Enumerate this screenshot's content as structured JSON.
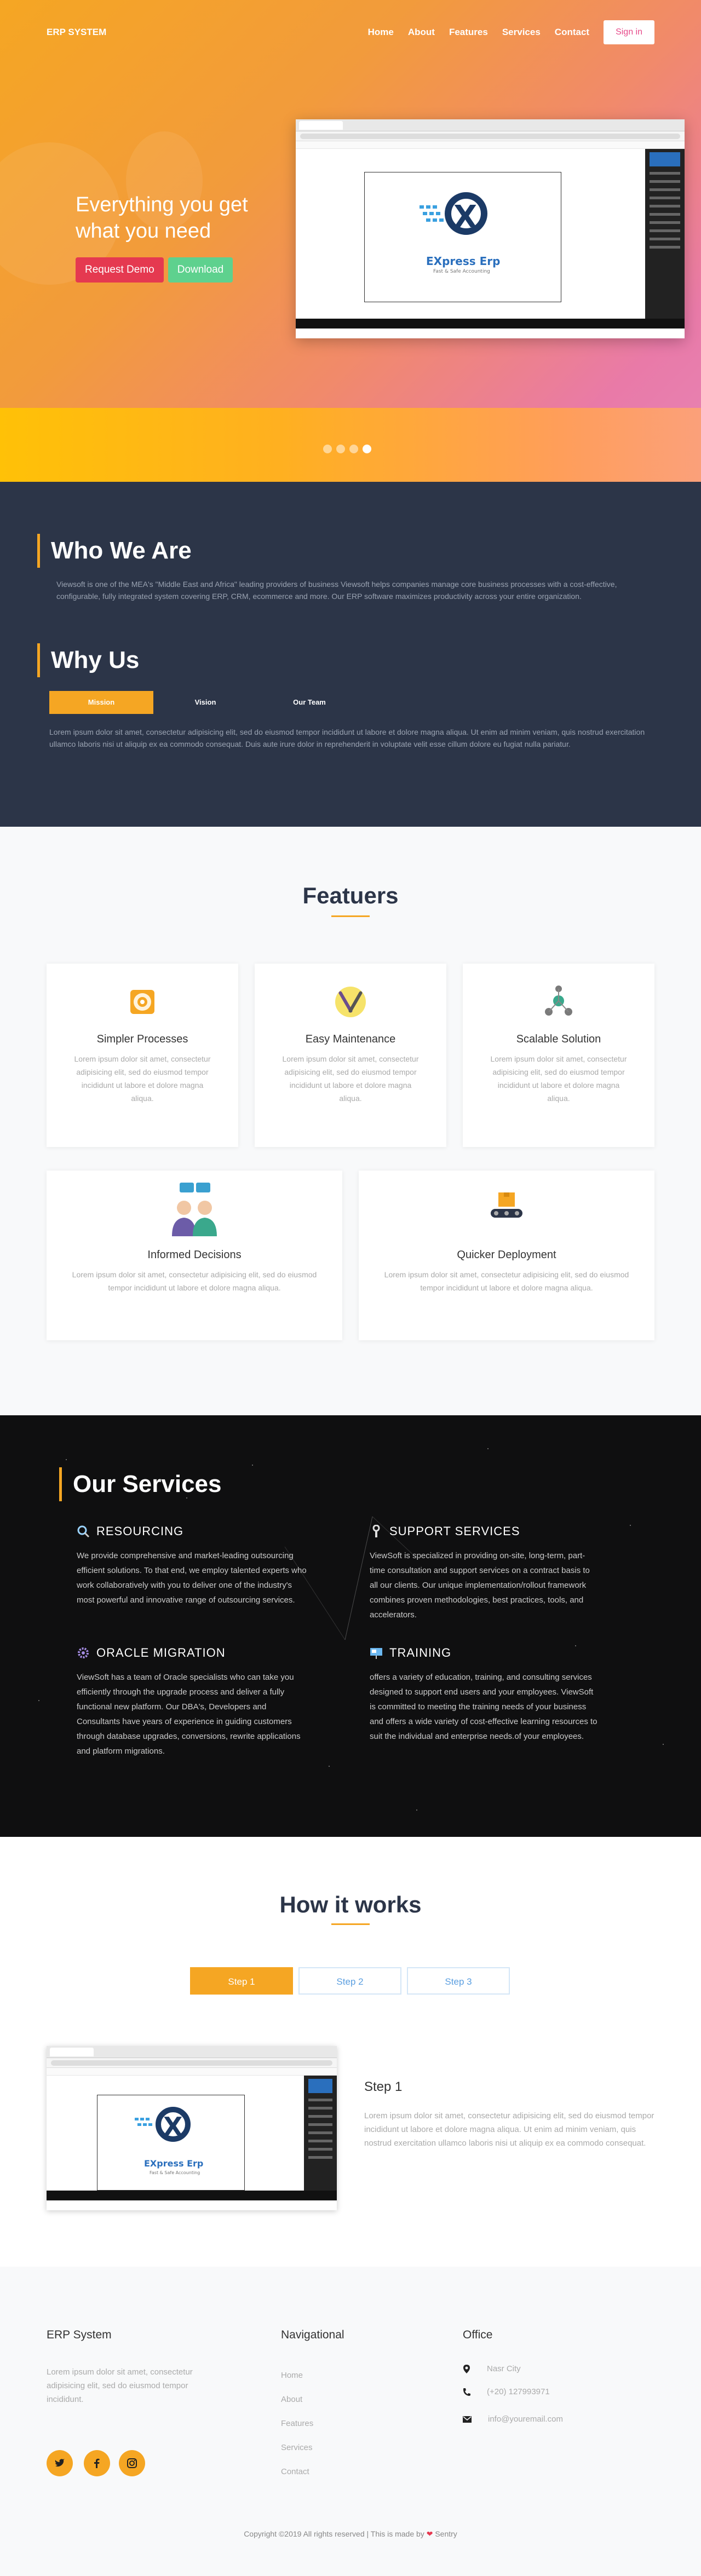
{
  "nav": {
    "logo": "ERP SYSTEM",
    "links": [
      "Home",
      "About",
      "Features",
      "Services",
      "Contact"
    ],
    "signin": "Sign in"
  },
  "hero": {
    "title": "Everything you get what you need",
    "btn_demo": "Request Demo",
    "btn_download": "Download",
    "logo_text": "EXpress Erp",
    "logo_tag": "Fast & Safe Accounting",
    "slide_count": 4,
    "active_slide": 4
  },
  "about": {
    "who_title": "Who We Are",
    "who_text": "Viewsoft is one of the MEA's \"Middle East and Africa\" leading providers of business Viewsoft helps companies manage core business processes with a cost-effective, configurable, fully integrated system covering ERP, CRM, ecommerce and more. Our ERP software maximizes productivity across your entire organization.",
    "why_title": "Why Us",
    "tabs": [
      "Mission",
      "Vision",
      "Our Team"
    ],
    "tab_text": "Lorem ipsum dolor sit amet, consectetur adipisicing elit, sed do eiusmod tempor incididunt ut labore et dolore magna aliqua. Ut enim ad minim veniam, quis nostrud exercitation ullamco laboris nisi ut aliquip ex ea commodo consequat. Duis aute irure dolor in reprehenderit in voluptate velit esse cillum dolore eu fugiat nulla pariatur."
  },
  "features": {
    "title": "Featuers",
    "items": [
      {
        "title": "Simpler Processes",
        "text": "Lorem ipsum dolor sit amet, consectetur adipisicing elit, sed do eiusmod tempor incididunt ut labore et dolore magna aliqua.",
        "icon": "gear-box-icon"
      },
      {
        "title": "Easy Maintenance",
        "text": "Lorem ipsum dolor sit amet, consectetur adipisicing elit, sed do eiusmod tempor incididunt ut labore et dolore magna aliqua.",
        "icon": "tools-icon"
      },
      {
        "title": "Scalable Solution",
        "text": "Lorem ipsum dolor sit amet, consectetur adipisicing elit, sed do eiusmod tempor incididunt ut labore et dolore magna aliqua.",
        "icon": "network-icon"
      },
      {
        "title": "Informed Decisions",
        "text": "Lorem ipsum dolor sit amet, consectetur adipisicing elit, sed do eiusmod tempor incididunt ut labore et dolore magna aliqua.",
        "icon": "people-chat-icon"
      },
      {
        "title": "Quicker Deployment",
        "text": "Lorem ipsum dolor sit amet, consectetur adipisicing elit, sed do eiusmod tempor incididunt ut labore et dolore magna aliqua.",
        "icon": "conveyor-icon"
      }
    ]
  },
  "services": {
    "title": "Our Services",
    "items": [
      {
        "title": "RESOURCING",
        "text": "We provide comprehensive and market-leading outsourcing efficient solutions. To that end, we employ talented experts who work collaboratively with you to deliver one of the industry's most powerful and innovative range of outsourcing services.",
        "icon": "magnifier-icon"
      },
      {
        "title": "SUPPORT SERVICES",
        "text": "ViewSoft is specialized in providing on-site, long-term, part-time consultation and support services on a contract basis to all our clients. Our unique implementation/rollout framework combines proven methodologies, best practices, tools, and accelerators.",
        "icon": "wrench-icon"
      },
      {
        "title": "ORACLE MIGRATION",
        "text": "ViewSoft has a team of Oracle specialists who can take you efficiently through the upgrade process and deliver a fully functional new platform. Our DBA's, Developers and Consultants have years of experience in guiding customers through database upgrades, conversions, rewrite applications and platform migrations.",
        "icon": "cog-icon"
      },
      {
        "title": "TRAINING",
        "text": "offers a variety of education, training, and consulting services designed to support end users and your employees. ViewSoft is committed to meeting the training needs of your business and offers a wide variety of cost-effective learning resources to suit the individual and enterprise needs.of your employees.",
        "icon": "presentation-icon"
      }
    ]
  },
  "how": {
    "title": "How it works",
    "steps": [
      "Step 1",
      "Step 2",
      "Step 3"
    ],
    "step_title": "Step 1",
    "step_text": "Lorem ipsum dolor sit amet, consectetur adipisicing elit, sed do eiusmod tempor incididunt ut labore et dolore magna aliqua. Ut enim ad minim veniam, quis nostrud exercitation ullamco laboris nisi ut aliquip ex ea commodo consequat."
  },
  "footer": {
    "col1_title": "ERP System",
    "col1_text": "Lorem ipsum dolor sit amet, consectetur adipisicing elit, sed do eiusmod tempor incididunt.",
    "col2_title": "Navigational",
    "links": [
      "Home",
      "About",
      "Features",
      "Services",
      "Contact"
    ],
    "col3_title": "Office",
    "address": "Nasr City",
    "phone": "(+20) 127993971",
    "email": "info@youremail.com",
    "copyright_pre": "Copyright ©2019 All rights reserved | This is made by",
    "copyright_post": "Sentry"
  },
  "colors": {
    "accent": "#f5a623",
    "dark": "#2c3548",
    "demo": "#e53950",
    "download": "#5ed18e"
  }
}
